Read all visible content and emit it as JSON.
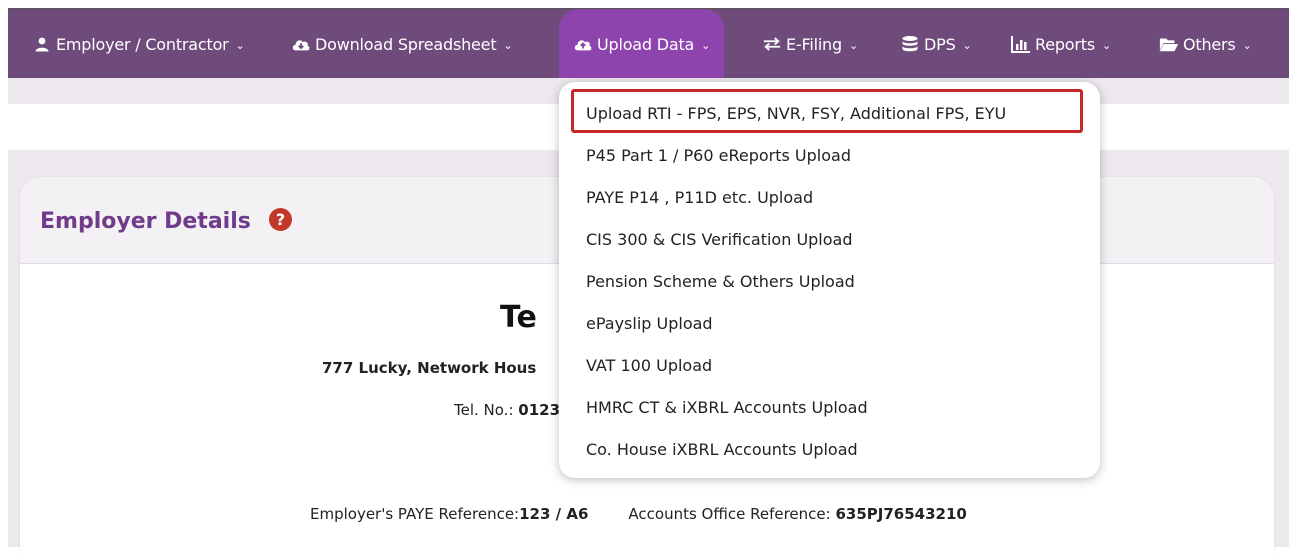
{
  "nav": {
    "items": [
      {
        "label": "Employer / Contractor",
        "icon": "user-icon"
      },
      {
        "label": "Download Spreadsheet",
        "icon": "cloud-download-icon"
      },
      {
        "label": "Upload Data",
        "icon": "cloud-upload-icon",
        "active": true
      },
      {
        "label": "E-Filing",
        "icon": "exchange-icon"
      },
      {
        "label": "DPS",
        "icon": "database-icon"
      },
      {
        "label": "Reports",
        "icon": "bar-chart-icon"
      },
      {
        "label": "Others",
        "icon": "folder-open-icon"
      }
    ]
  },
  "card": {
    "title": "Employer Details",
    "help": "?",
    "company_name_partial": "Te",
    "address_partial": "777 Lucky, Network Hous",
    "tel_label": "Tel. No.: ",
    "tel_partial": "0123",
    "paye_label": "Employer's PAYE Reference:",
    "paye_value": "123 / A6",
    "accounts_label": "Accounts Office Reference: ",
    "accounts_value": "635PJ76543210"
  },
  "dropdown": {
    "items": [
      "Upload RTI - FPS, EPS, NVR, FSY, Additional FPS, EYU",
      "P45 Part 1 / P60 eReports Upload",
      "PAYE P14 , P11D etc. Upload",
      "CIS 300 & CIS Verification Upload",
      "Pension Scheme & Others Upload",
      "ePayslip Upload",
      "VAT 100 Upload",
      "HMRC CT & iXBRL Accounts Upload",
      "Co. House iXBRL Accounts Upload"
    ],
    "highlighted_index": 0
  },
  "colors": {
    "nav_bg": "#6f4b7c",
    "nav_active": "#8e44ad",
    "title": "#6f3b8a",
    "highlight": "#c62828"
  }
}
